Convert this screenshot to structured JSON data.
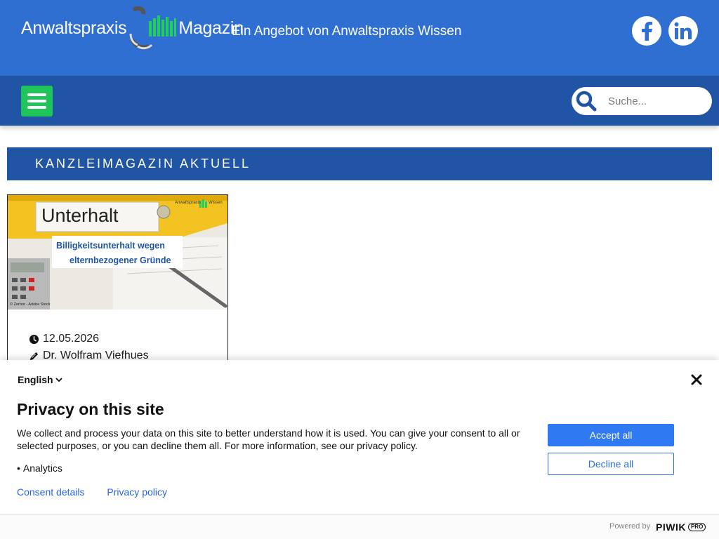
{
  "header": {
    "logo_left": "Anwaltspraxis",
    "logo_right": "Magazin",
    "tagline": "Ein Angebot von Anwaltspraxis Wissen",
    "social": [
      {
        "name": "facebook-icon"
      },
      {
        "name": "linkedin-icon"
      }
    ]
  },
  "nav": {
    "search_placeholder": "Suche..."
  },
  "section": {
    "title": "KANZLEIMAGAZIN AKTUELL"
  },
  "article": {
    "image": {
      "folder_label": "Unterhalt",
      "brand_left": "Anwaltspraxis",
      "brand_right": "Wissen",
      "headline_line1": "Billigkeitsunterhalt wegen",
      "headline_line2": "elternbezogener Gründe",
      "credit": "© Zerbor - Adobe Stock"
    },
    "date": "12.05.2026",
    "author": "Dr. Wolfram Viefhues"
  },
  "consent": {
    "language": "English",
    "title": "Privacy on this site",
    "description": "We collect and process your data on this site to better understand how it is used. You can give your consent to all or selected purposes, or you can decline them all. For more information, see our privacy policy.",
    "purposes": [
      "Analytics"
    ],
    "links": {
      "details": "Consent details",
      "policy": "Privacy policy"
    },
    "accept_label": "Accept all",
    "decline_label": "Decline all",
    "powered_by": "Powered by",
    "brand": "PIWIK",
    "brand_badge": "PRO"
  },
  "colors": {
    "header_blue": "#2f6fd1",
    "nav_blue": "#1f55a4",
    "menu_green": "#1fc55a",
    "accept_blue": "#2f7af2"
  }
}
